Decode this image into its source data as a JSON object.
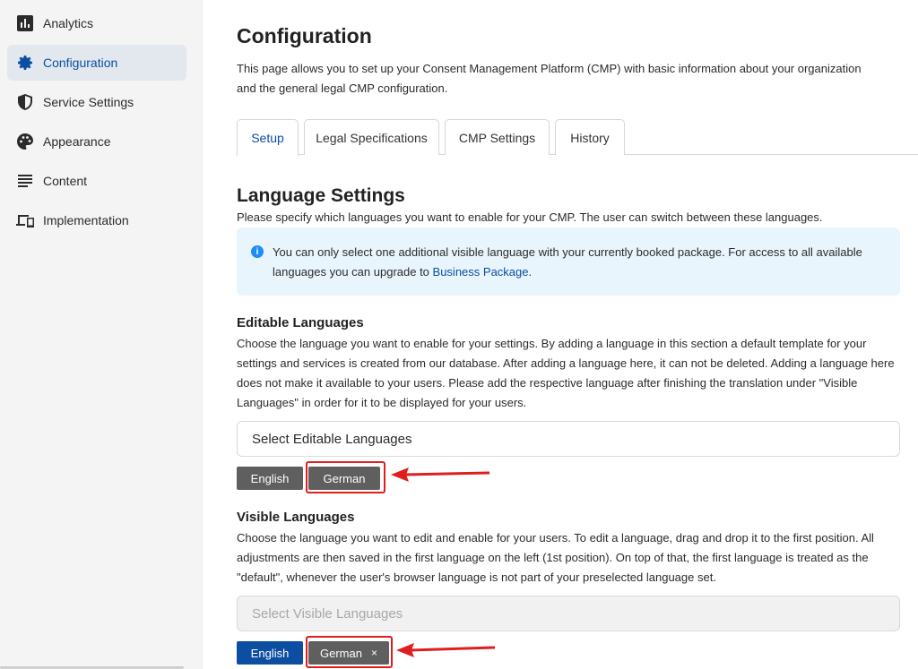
{
  "sidebar": {
    "items": [
      {
        "label": "Analytics",
        "icon": "bar-chart-icon"
      },
      {
        "label": "Configuration",
        "icon": "gear-icon",
        "active": true
      },
      {
        "label": "Service Settings",
        "icon": "shield-icon"
      },
      {
        "label": "Appearance",
        "icon": "palette-icon"
      },
      {
        "label": "Content",
        "icon": "text-lines-icon"
      },
      {
        "label": "Implementation",
        "icon": "devices-icon"
      }
    ]
  },
  "main": {
    "title": "Configuration",
    "description": "This page allows you to set up your Consent Management Platform (CMP) with basic information about your organization and the general legal CMP configuration.",
    "tabs": [
      {
        "label": "Setup",
        "active": true
      },
      {
        "label": "Legal Specifications"
      },
      {
        "label": "CMP Settings"
      },
      {
        "label": "History"
      }
    ]
  },
  "language_settings": {
    "title": "Language Settings",
    "description": "Please specify which languages you want to enable for your CMP. The user can switch between these languages.",
    "info": {
      "text_before": "You can only select one additional visible language with your currently booked package. For access to all available languages you can upgrade to ",
      "link": "Business Package",
      "text_after": "."
    }
  },
  "editable": {
    "title": "Editable Languages",
    "description": "Choose the language you want to enable for your settings. By adding a language in this section a default template for your settings and services is created from our database. After adding a language here, it can not be deleted. Adding a language here does not make it available to your users. Please add the respective language after finishing the translation under \"Visible Languages\" in order for it to be displayed for your users.",
    "placeholder": "Select Editable Languages",
    "chips": [
      "English",
      "German"
    ]
  },
  "visible": {
    "title": "Visible Languages",
    "description": "Choose the language you want to edit and enable for your users. To edit a language, drag and drop it to the first position. All adjustments are then saved in the first language on the left (1st position). On top of that, the first language is treated as the \"default\", whenever the user's browser language is not part of your preselected language set.",
    "placeholder": "Select Visible Languages",
    "chips": [
      "English",
      "German"
    ],
    "remove_glyph": "×"
  },
  "colors": {
    "accent": "#0b4ea2",
    "annotation": "#e01e1e",
    "info_bg": "#e9f5fd"
  }
}
